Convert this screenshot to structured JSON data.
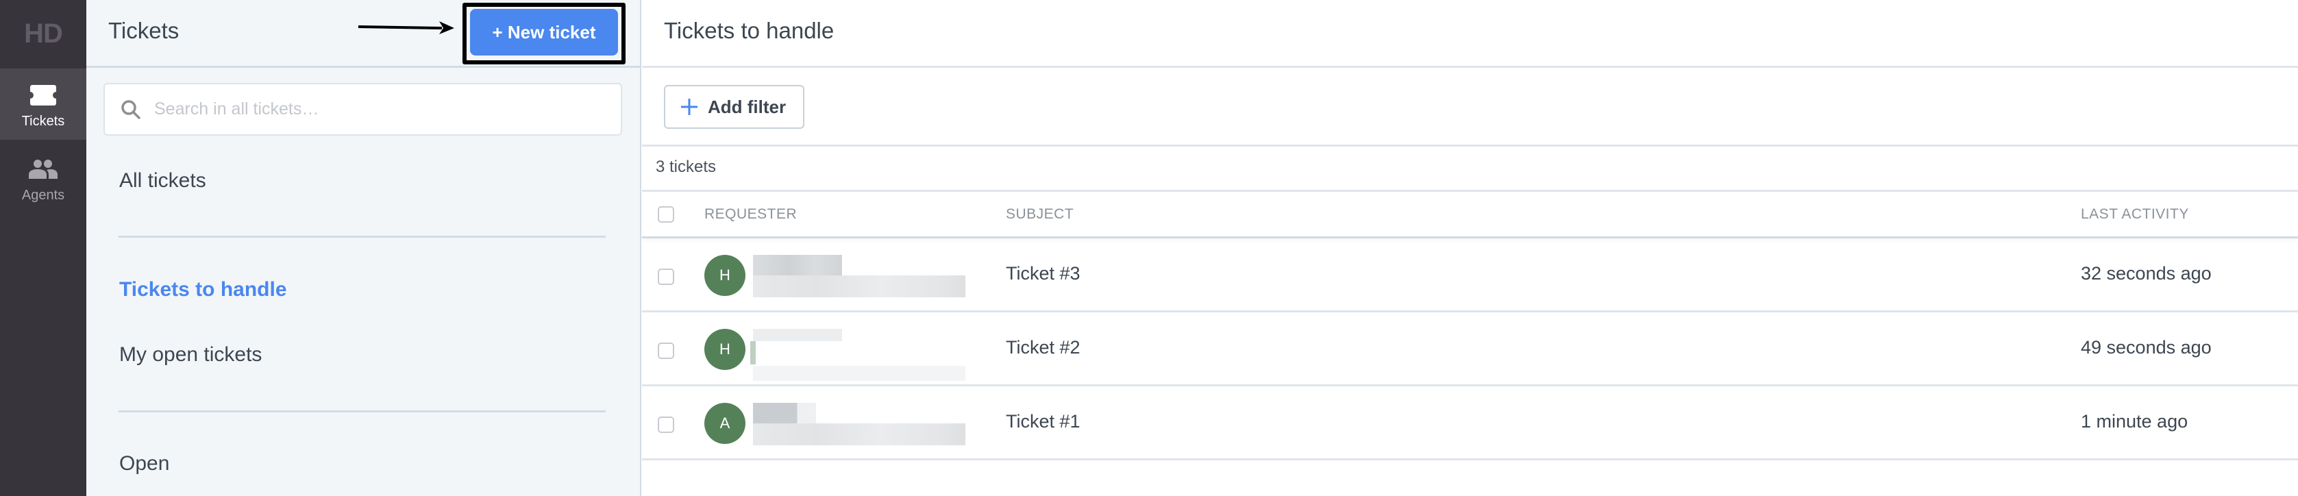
{
  "app": {
    "logo": "HD"
  },
  "nav": {
    "items": [
      {
        "label": "Tickets",
        "icon": "ticket-icon",
        "active": true
      },
      {
        "label": "Agents",
        "icon": "agents-icon",
        "active": false
      }
    ]
  },
  "panel": {
    "title": "Tickets",
    "new_ticket_label": "+ New ticket",
    "search": {
      "placeholder": "Search in all tickets…",
      "value": ""
    },
    "links": [
      {
        "label": "All tickets",
        "active": false
      },
      {
        "label": "Tickets to handle",
        "active": true
      },
      {
        "label": "My open tickets",
        "active": false
      },
      {
        "label": "Open",
        "active": false
      }
    ]
  },
  "main": {
    "title": "Tickets to handle",
    "add_filter_label": "Add filter",
    "count_label": "3 tickets",
    "columns": [
      "REQUESTER",
      "SUBJECT",
      "LAST ACTIVITY"
    ],
    "rows": [
      {
        "avatar_initial": "H",
        "subject": "Ticket #3",
        "last_activity": "32 seconds ago"
      },
      {
        "avatar_initial": "H",
        "subject": "Ticket #2",
        "last_activity": "49 seconds ago"
      },
      {
        "avatar_initial": "A",
        "subject": "Ticket #1",
        "last_activity": "1 minute ago"
      }
    ]
  },
  "colors": {
    "accent": "#4a87ee",
    "nav_bg": "#38343b",
    "nav_active_bg": "#4c4850",
    "avatar_bg": "#558158",
    "panel_bg": "#f2f6f9"
  }
}
